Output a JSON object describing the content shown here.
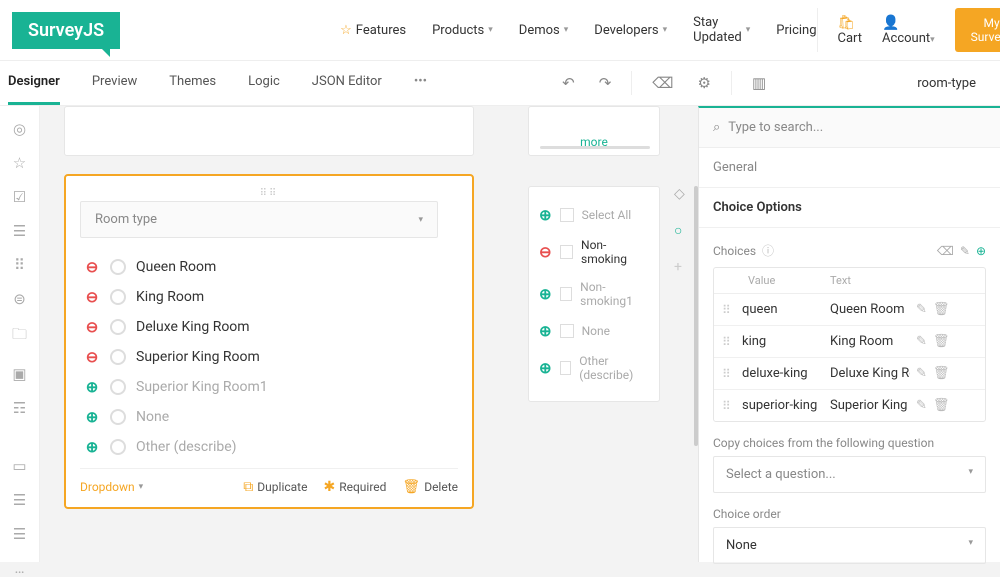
{
  "brand": "SurveyJS",
  "topnav": {
    "features": "Features",
    "products": "Products",
    "demos": "Demos",
    "developers": "Developers",
    "stay": "Stay Updated",
    "pricing": "Pricing",
    "cart": "Cart",
    "account": "Account",
    "mysurveys": "My Surveys"
  },
  "tabs": {
    "designer": "Designer",
    "preview": "Preview",
    "themes": "Themes",
    "logic": "Logic",
    "json": "JSON Editor"
  },
  "crumb": "room-type",
  "dropdown": {
    "title": "Room type"
  },
  "opts": {
    "o1": "Queen Room",
    "o2": "King Room",
    "o3": "Deluxe King Room",
    "o4": "Superior King Room",
    "o5": "Superior King Room1",
    "none": "None",
    "other": "Other (describe)"
  },
  "morelink": "more",
  "qtype": "Dropdown",
  "actions": {
    "dup": "Duplicate",
    "req": "Required",
    "del": "Delete"
  },
  "side": {
    "selectall": "Select All",
    "nonsmoking": "Non-smoking",
    "nonsmoking1": "Non-smoking1",
    "none": "None",
    "other": "Other (describe)"
  },
  "prop": {
    "search_ph": "Type to search...",
    "general": "General",
    "choiceopts": "Choice Options",
    "choices": "Choices",
    "valueh": "Value",
    "texth": "Text",
    "copylbl": "Copy choices from the following question",
    "selectq": "Select a question...",
    "orderlbl": "Choice order",
    "ordval": "None"
  },
  "rows": [
    {
      "value": "queen",
      "text": "Queen Room"
    },
    {
      "value": "king",
      "text": "King Room"
    },
    {
      "value": "deluxe-king",
      "text": "Deluxe King Ro"
    },
    {
      "value": "superior-king",
      "text": "Superior King"
    }
  ]
}
